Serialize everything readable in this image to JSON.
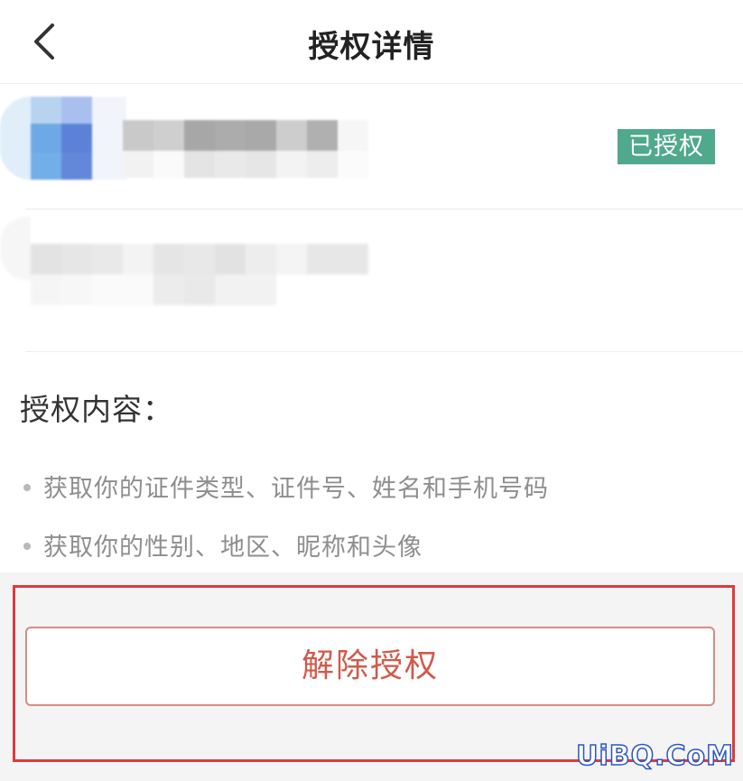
{
  "header": {
    "title": "授权详情",
    "back_icon": "chevron-left-icon"
  },
  "app": {
    "status_badge": "已授权",
    "badge_color": "#4fa98a"
  },
  "content": {
    "section_title": "授权内容：",
    "permissions": [
      "获取你的证件类型、证件号、姓名和手机号码",
      "获取你的性别、地区、昵称和头像"
    ]
  },
  "actions": {
    "revoke_label": "解除授权",
    "revoke_color": "#d05a4a"
  },
  "highlight_color": "#e03a3a",
  "watermark": "UiBQ.CoM"
}
